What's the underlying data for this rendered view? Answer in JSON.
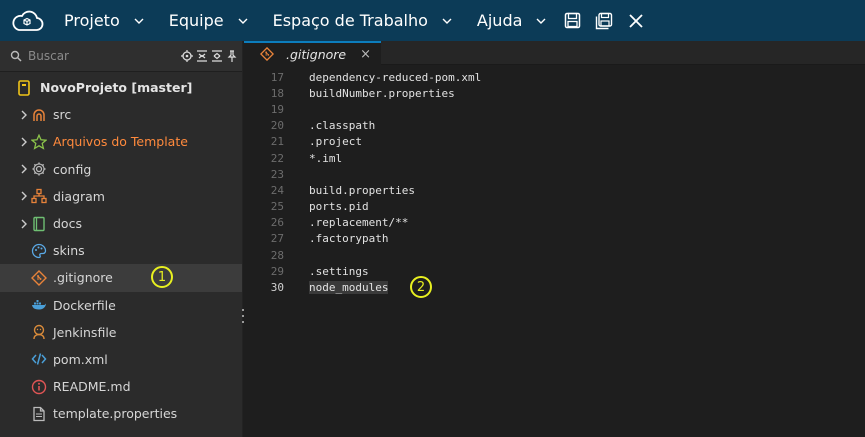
{
  "topbar": {
    "menu": [
      {
        "label": "Projeto"
      },
      {
        "label": "Equipe"
      },
      {
        "label": "Espaço de Trabalho"
      },
      {
        "label": "Ajuda"
      }
    ],
    "icons": [
      "save-icon",
      "save-all-icon",
      "close-icon"
    ]
  },
  "sidebar": {
    "search_placeholder": "Buscar",
    "root": {
      "label": "NovoProjeto [master]"
    },
    "items": [
      {
        "label": "src",
        "icon": "src-folder-icon",
        "expandable": true
      },
      {
        "label": "Arquivos do Template",
        "icon": "star-icon",
        "expandable": true,
        "color": "#ff8a3d"
      },
      {
        "label": "config",
        "icon": "gear-icon",
        "expandable": true
      },
      {
        "label": "diagram",
        "icon": "diagram-icon",
        "expandable": true
      },
      {
        "label": "docs",
        "icon": "book-icon",
        "expandable": true
      },
      {
        "label": "skins",
        "icon": "palette-icon",
        "expandable": false
      },
      {
        "label": ".gitignore",
        "icon": "git-icon",
        "expandable": false,
        "selected": true
      },
      {
        "label": "Dockerfile",
        "icon": "docker-icon",
        "expandable": false
      },
      {
        "label": "Jenkinsfile",
        "icon": "jenkins-icon",
        "expandable": false
      },
      {
        "label": "pom.xml",
        "icon": "code-icon",
        "expandable": false
      },
      {
        "label": "README.md",
        "icon": "info-icon",
        "expandable": false
      },
      {
        "label": "template.properties",
        "icon": "file-icon",
        "expandable": false
      }
    ],
    "badge": "1"
  },
  "editor": {
    "tab": {
      "label": ".gitignore",
      "close": "×"
    },
    "lines": [
      {
        "n": "17",
        "text": "dependency-reduced-pom.xml"
      },
      {
        "n": "18",
        "text": "buildNumber.properties"
      },
      {
        "n": "19",
        "text": ""
      },
      {
        "n": "20",
        "text": ".classpath"
      },
      {
        "n": "21",
        "text": ".project"
      },
      {
        "n": "22",
        "text": "*.iml"
      },
      {
        "n": "23",
        "text": ""
      },
      {
        "n": "24",
        "text": "build.properties"
      },
      {
        "n": "25",
        "text": "ports.pid"
      },
      {
        "n": "26",
        "text": ".replacement/**"
      },
      {
        "n": "27",
        "text": ".factorypath"
      },
      {
        "n": "28",
        "text": ""
      },
      {
        "n": "29",
        "text": ".settings"
      },
      {
        "n": "30",
        "text": "node_modules",
        "current": true
      }
    ],
    "badge": "2"
  },
  "colors": {
    "topbar": "#0c3b57",
    "accent": "#0c7dbd",
    "badge": "#e8f020"
  }
}
